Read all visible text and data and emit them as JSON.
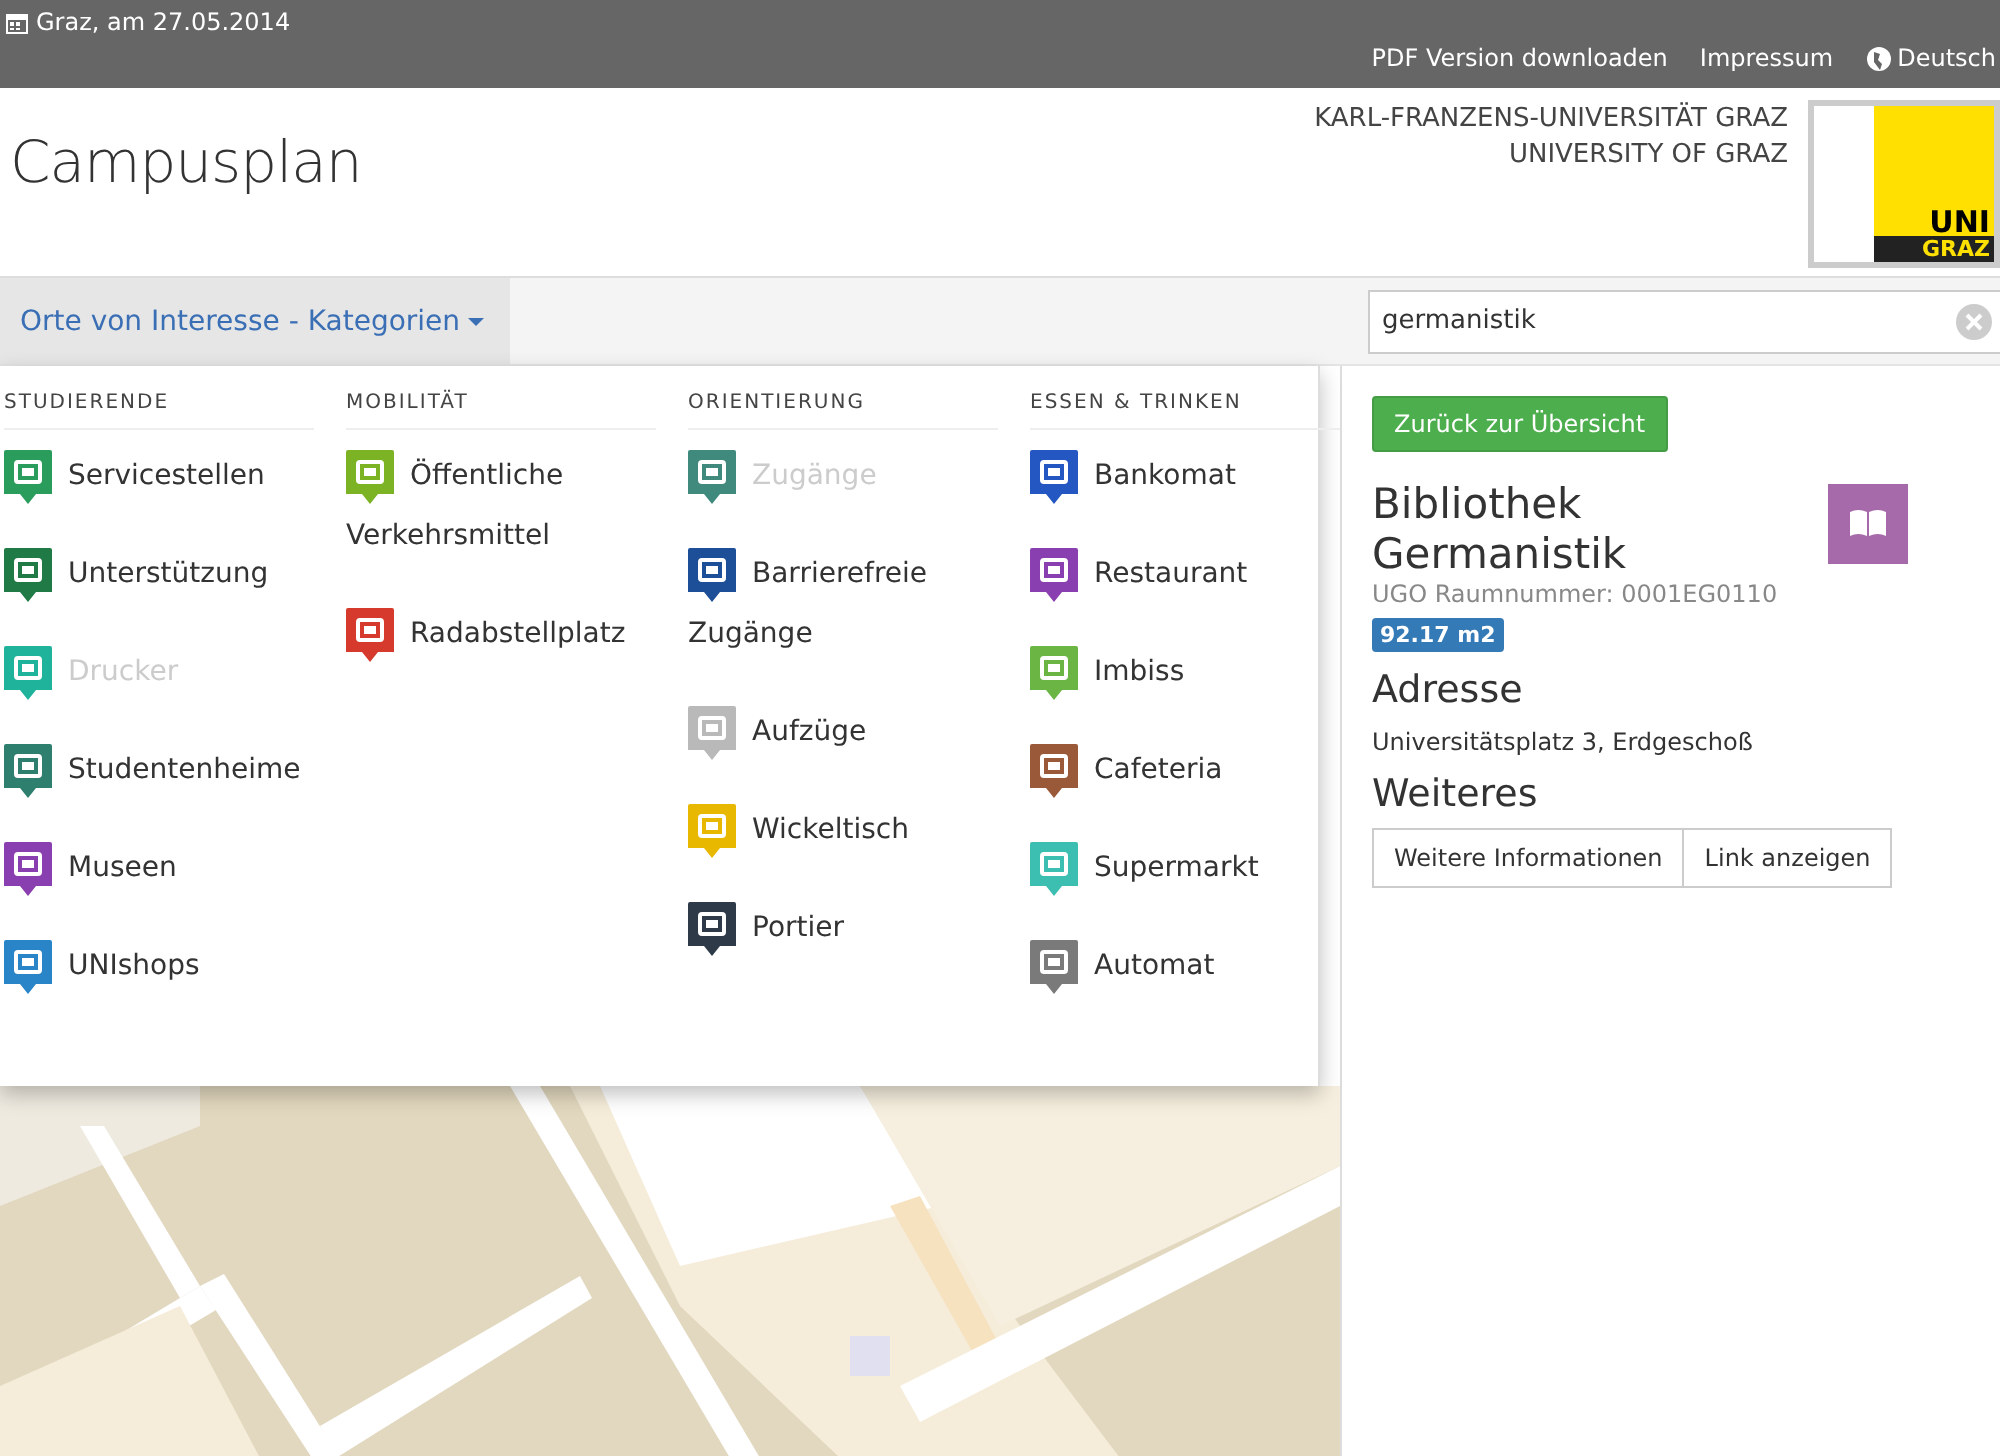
{
  "top_bar": {
    "date": "Graz, am 27.05.2014",
    "links": [
      "PDF Version downloaden",
      "Impressum"
    ],
    "language": "Deutsch"
  },
  "header": {
    "title": "Campusplan",
    "university_lines": [
      "KARL-FRANZENS-UNIVERSITÄT GRAZ",
      "UNIVERSITY OF GRAZ"
    ],
    "logo": [
      "UNI",
      "GRAZ"
    ]
  },
  "nav": {
    "dropdown": "Orte von Interesse - Kategorien",
    "expanded": true,
    "search": {
      "value": "germanistik"
    }
  },
  "menu": [
    {
      "heading": "STUDIERENDE",
      "items": [
        {
          "label": "Servicestellen",
          "color": "#2a9d5c",
          "disabled": false
        },
        {
          "label": "Unterstützung",
          "color": "#1f7a45",
          "disabled": false
        },
        {
          "label": "Drucker",
          "color": "#1fb39b",
          "disabled": true
        },
        {
          "label": "Studentenheime",
          "color": "#2f7f6e",
          "disabled": false
        },
        {
          "label": "Museen",
          "color": "#8a3fb0",
          "disabled": false
        },
        {
          "label": "UNIshops",
          "color": "#2a85c8",
          "disabled": false
        }
      ]
    },
    {
      "heading": "MOBILITÄT",
      "items": [
        {
          "label": "Öffentliche Verkehrsmittel",
          "color": "#7cb325",
          "disabled": false
        },
        {
          "label": "Radabstellplatz",
          "color": "#d63a2c",
          "disabled": false
        }
      ]
    },
    {
      "heading": "ORIENTIERUNG",
      "items": [
        {
          "label": "Zugänge",
          "color": "#3f8a7c",
          "disabled": true
        },
        {
          "label": "Barrierefreie Zugänge",
          "color": "#1c4f98",
          "disabled": false
        },
        {
          "label": "Aufzüge",
          "color": "#b9b9b9",
          "disabled": false
        },
        {
          "label": "Wickeltisch",
          "color": "#e8b800",
          "disabled": false
        },
        {
          "label": "Portier",
          "color": "#2e3a48",
          "disabled": false
        }
      ]
    },
    {
      "heading": "ESSEN & TRINKEN",
      "items": [
        {
          "label": "Bankomat",
          "color": "#2457c2",
          "disabled": false
        },
        {
          "label": "Restaurant",
          "color": "#8a3fb0",
          "disabled": false
        },
        {
          "label": "Imbiss",
          "color": "#6ab544",
          "disabled": false
        },
        {
          "label": "Cafeteria",
          "color": "#9a5a3a",
          "disabled": false
        },
        {
          "label": "Supermarkt",
          "color": "#3cbfb0",
          "disabled": false
        },
        {
          "label": "Automat",
          "color": "#7a7a7a",
          "disabled": false
        }
      ]
    }
  ],
  "detail": {
    "back_button": "Zurück zur Übersicht",
    "title": "Bibliothek Germanistik",
    "room": "UGO Raumnummer: 0001EG0110",
    "area": "92.17 m2",
    "address_heading": "Adresse",
    "address": "Universitätsplatz 3, Erdgeschoß",
    "more_heading": "Weiteres",
    "buttons": [
      "Weitere Informationen",
      "Link anzeigen"
    ]
  }
}
